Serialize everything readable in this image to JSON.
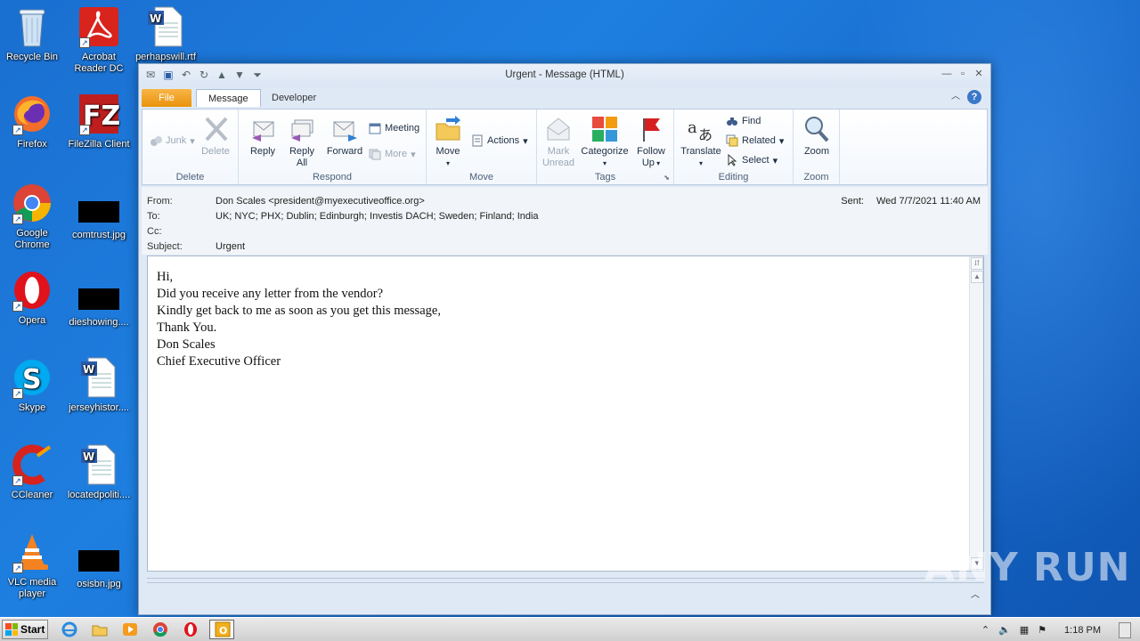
{
  "desktop": {
    "icons": [
      {
        "label": "Recycle Bin",
        "icon": "recycle-bin-icon"
      },
      {
        "label": "Acrobat Reader DC",
        "icon": "acrobat-icon"
      },
      {
        "label": "perhapswill.rtf",
        "icon": "word-document-icon"
      },
      {
        "label": "Firefox",
        "icon": "firefox-icon"
      },
      {
        "label": "FileZilla Client",
        "icon": "filezilla-icon"
      },
      {
        "label": "Google Chrome",
        "icon": "chrome-icon"
      },
      {
        "label": "comtrust.jpg",
        "icon": "image-thumbnail-icon"
      },
      {
        "label": "Opera",
        "icon": "opera-icon"
      },
      {
        "label": "dieshowing....",
        "icon": "image-thumbnail-icon"
      },
      {
        "label": "Skype",
        "icon": "skype-icon"
      },
      {
        "label": "jerseyhistor....",
        "icon": "word-document-icon"
      },
      {
        "label": "CCleaner",
        "icon": "ccleaner-icon"
      },
      {
        "label": "locatedpoliti....",
        "icon": "word-document-icon"
      },
      {
        "label": "VLC media player",
        "icon": "vlc-icon"
      },
      {
        "label": "osisbn.jpg",
        "icon": "image-thumbnail-icon"
      }
    ]
  },
  "window": {
    "title": "Urgent - Message (HTML)",
    "tabs": {
      "file": "File",
      "message": "Message",
      "developer": "Developer"
    },
    "ribbon": {
      "delete_group": {
        "label": "Delete",
        "junk": "Junk",
        "delete": "Delete"
      },
      "respond_group": {
        "label": "Respond",
        "reply": "Reply",
        "reply_all": "Reply All",
        "forward": "Forward",
        "meeting": "Meeting",
        "more": "More"
      },
      "move_group": {
        "label": "Move",
        "move": "Move",
        "actions": "Actions"
      },
      "tags_group": {
        "label": "Tags",
        "mark_unread": "Mark Unread",
        "categorize": "Categorize",
        "follow_up": "Follow Up"
      },
      "editing_group": {
        "label": "Editing",
        "translate": "Translate",
        "find": "Find",
        "related": "Related",
        "select": "Select"
      },
      "zoom_group": {
        "label": "Zoom",
        "zoom": "Zoom"
      }
    },
    "headers": {
      "from_label": "From:",
      "from": "Don Scales <president@myexecutiveoffice.org>",
      "to_label": "To:",
      "to": "UK; NYC; PHX; Dublin; Edinburgh; Investis DACH; Sweden; Finland; India",
      "cc_label": "Cc:",
      "cc": "",
      "subject_label": "Subject:",
      "subject": "Urgent",
      "sent_label": "Sent:",
      "sent": "Wed 7/7/2021 11:40 AM"
    },
    "body_lines": [
      "Hi,",
      "Did you receive any letter from the vendor?",
      "Kindly get back to me as soon as you get this message,",
      "Thank You.",
      "Don Scales",
      "Chief Executive Officer"
    ]
  },
  "taskbar": {
    "start": "Start",
    "clock": "1:18 PM"
  },
  "watermark": "ANY RUN",
  "colors": {
    "file_tab": "#e9930c",
    "desktop": "#1a6fd0"
  }
}
